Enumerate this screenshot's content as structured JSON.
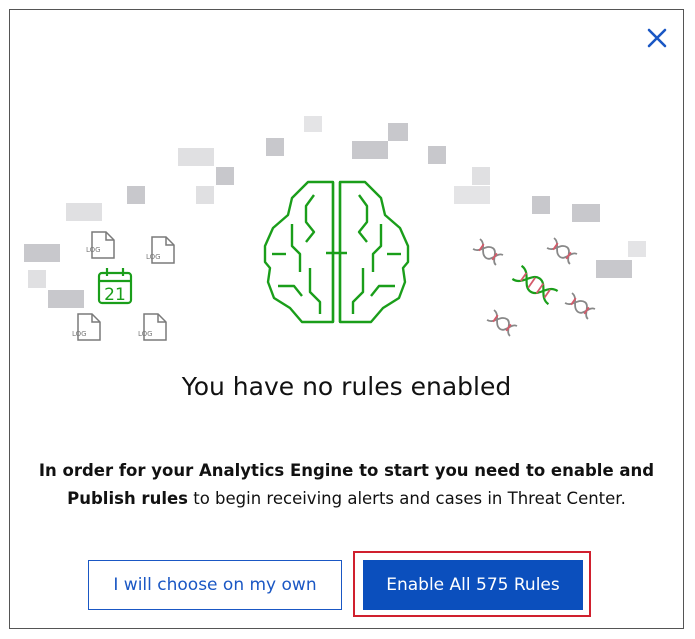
{
  "dialog": {
    "title": "You have no rules enabled",
    "desc_bold_1": "In order for your Analytics Engine to start you need to enable and",
    "desc_bold_2": "Publish rules",
    "desc_rest": " to begin receiving alerts and cases in Threat Center.",
    "secondary_button": "I will choose on my own",
    "primary_button": "Enable All 575 Rules",
    "close_icon": "close-icon"
  },
  "illustration": {
    "calendar_day": "21",
    "log_label": "LOG",
    "icons": [
      "brain-icon",
      "calendar-icon",
      "log-file-icon",
      "dna-icon"
    ]
  },
  "colors": {
    "brand_green": "#1a9e1a",
    "primary_blue": "#0b4fbd",
    "close_blue": "#1a57c4",
    "highlight_red": "#d0202e",
    "gray_block": "#c8c8cc"
  }
}
